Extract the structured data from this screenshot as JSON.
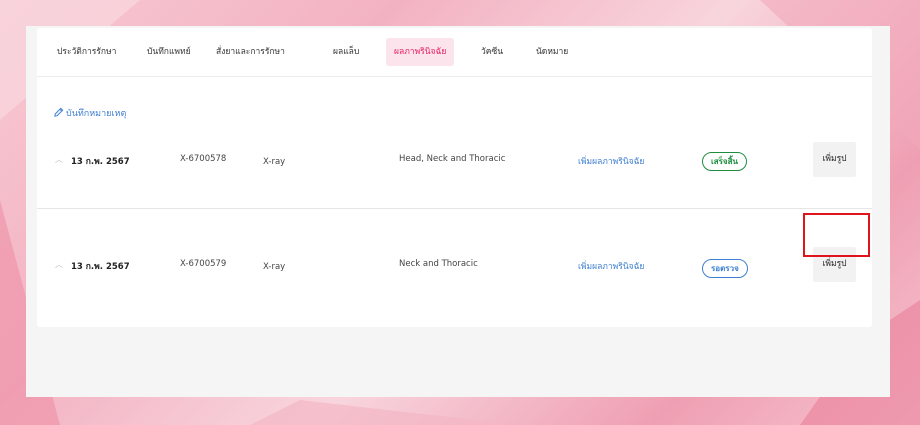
{
  "tabs": [
    {
      "label": "ประวัติการรักษา"
    },
    {
      "label": "บันทึกแพทย์"
    },
    {
      "label": "สั่งยาและการรักษา"
    },
    {
      "label": "ผลแล็บ"
    },
    {
      "label": "ผลภาพรินิจฉัย",
      "active": true
    },
    {
      "label": "วัคซีน"
    },
    {
      "label": "นัดหมาย"
    }
  ],
  "note_link": "บันทึกหมายเหตุ",
  "rows": [
    {
      "date": "13 ก.พ. 2567",
      "code": "X-6700578",
      "type": "X-ray",
      "description": "Head, Neck and Thoracic",
      "add_result": "เพิ่มผลภาพรินิจฉัย",
      "status": "เสร็จสิ้น",
      "status_color": "#1e8e3e",
      "add_image": "เพิ่มรูป"
    },
    {
      "date": "13 ก.พ. 2567",
      "code": "X-6700579",
      "type": "X-ray",
      "description": "Neck and Thoracic",
      "add_result": "เพิ่มผลภาพรินิจฉัย",
      "status": "รอตรวจ",
      "status_color": "#3f7fd1",
      "add_image": "เพิ่มรูป"
    }
  ],
  "colors": {
    "accent": "#e91e63",
    "link": "#3f7fd1",
    "highlight": "#e0141c"
  }
}
